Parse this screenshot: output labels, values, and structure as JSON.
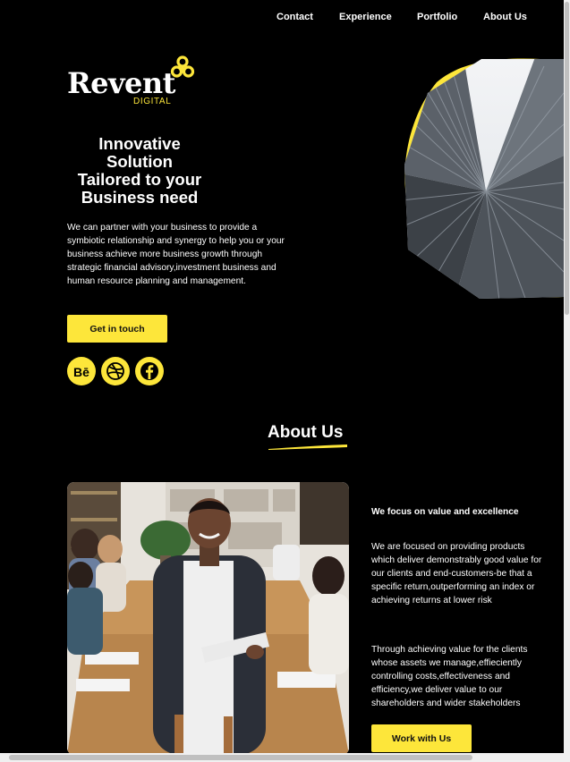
{
  "nav": {
    "items": [
      "Contact",
      "Experience",
      "Portfolio",
      "About Us"
    ]
  },
  "logo": {
    "word": "Revent",
    "sub": "DIGITAL"
  },
  "hero": {
    "title": "Innovative\nSolution\nTailored to your\nBusiness need",
    "description": "We can partner with your business to provide a symbiotic relationship and synergy to help you or your business achieve more business growth through strategic financial advisory,investment business and human resource planning and management.",
    "cta": "Get in touch"
  },
  "social": [
    {
      "icon": "behance-icon"
    },
    {
      "icon": "dribbble-icon"
    },
    {
      "icon": "facebook-icon"
    }
  ],
  "about": {
    "title": "About Us",
    "heading": "We focus on value and excellence",
    "para1": "We are focused on providing products which deliver demonstrably good value for our clients and end-customers-be that a specific return,outperforming an index or achieving returns at lower risk",
    "para2": "Through achieving value for the clients whose assets we manage,effieciently controlling costs,effectiveness and efficiency,we deliver value to our shareholders and wider stakeholders",
    "cta": "Work with Us"
  },
  "colors": {
    "accent": "#fde63a",
    "background": "#000000"
  }
}
